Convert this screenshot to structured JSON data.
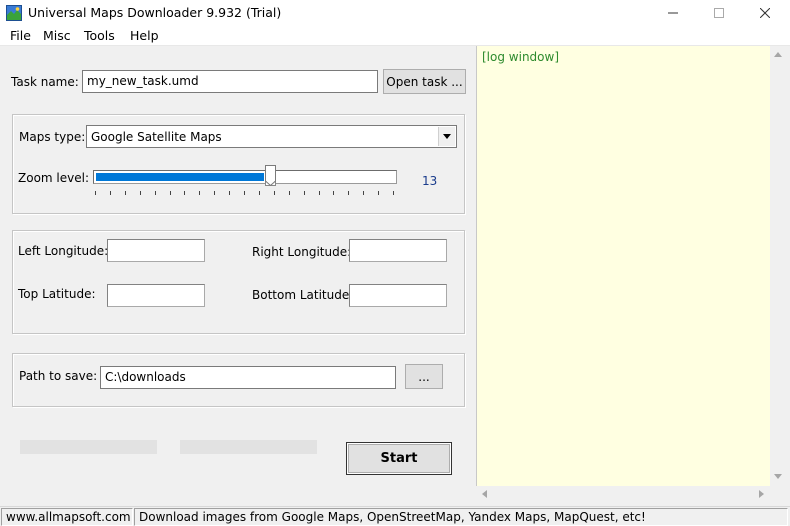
{
  "window": {
    "title": "Universal Maps Downloader 9.932 (Trial)",
    "controls": {
      "minimize": "—",
      "maximize": "☐",
      "close": "✕"
    }
  },
  "menu": {
    "items": [
      "File",
      "Misc",
      "Tools",
      "Help"
    ]
  },
  "task": {
    "label": "Task name:",
    "value": "my_new_task.umd",
    "open_button": "Open task ..."
  },
  "maps": {
    "type_label": "Maps type:",
    "type_value": "Google Satellite Maps",
    "zoom_label": "Zoom level:",
    "zoom_value": "13",
    "zoom_fraction": 0.6
  },
  "coords": {
    "left_longitude_label": "Left Longitude:",
    "right_longitude_label": "Right Longitude:",
    "top_latitude_label": "Top Latitude:",
    "bottom_latitude_label": "Bottom Latitude:",
    "left_longitude": "",
    "right_longitude": "",
    "top_latitude": "",
    "bottom_latitude": ""
  },
  "save": {
    "label": "Path to save:",
    "value": "C:\\downloads",
    "browse_button": "..."
  },
  "actions": {
    "start_button": "Start"
  },
  "log": {
    "text": "[log window]"
  },
  "status": {
    "site": "www.allmapsoft.com",
    "message": "Download images from Google Maps, OpenStreetMap, Yandex Maps, MapQuest, etc!"
  },
  "colors": {
    "accent": "#0078d7",
    "log_background": "#ffffe1",
    "log_text": "#2e8b2e",
    "zoom_value_text": "#1a3c8c"
  },
  "icons": {
    "app": "map-app-icon",
    "dropdown": "chevron-down-icon"
  }
}
